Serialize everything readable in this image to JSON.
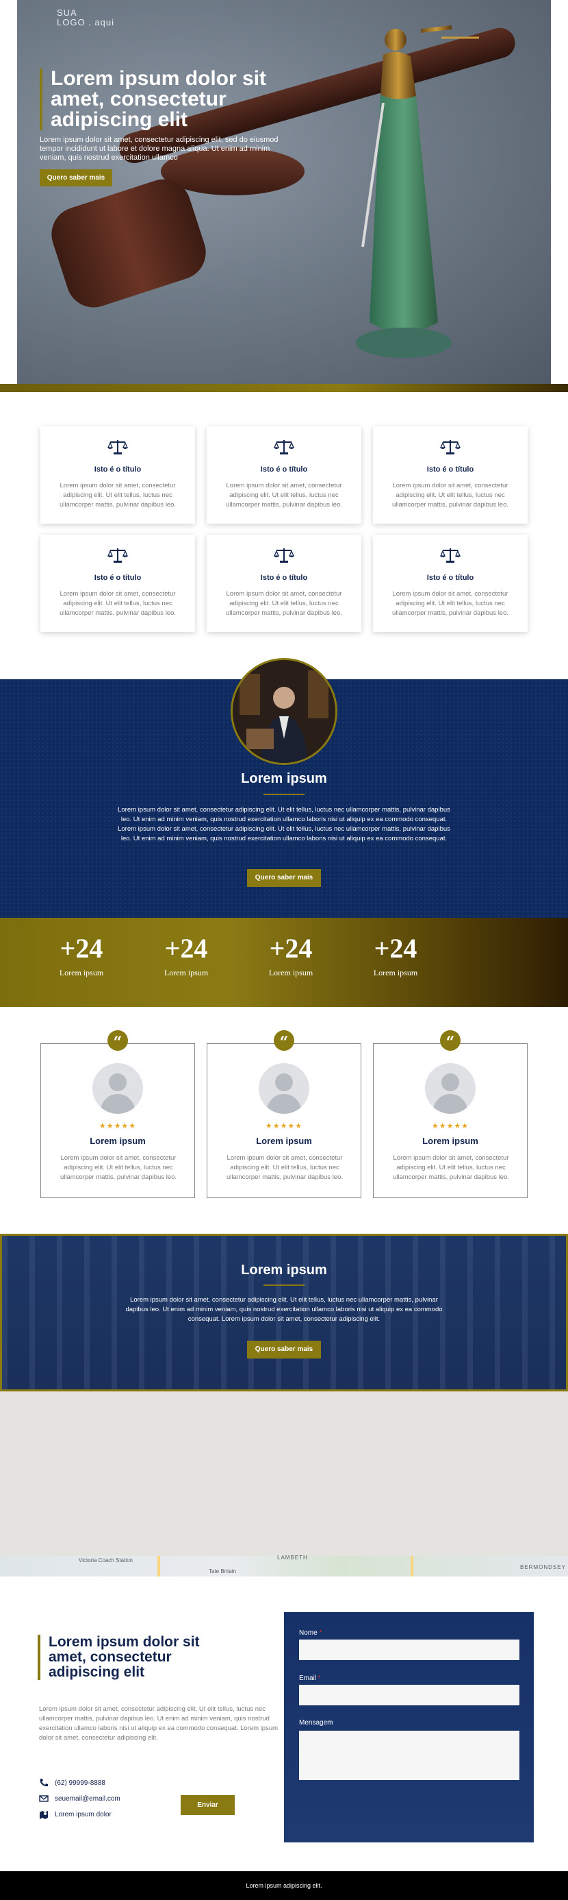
{
  "colors": {
    "navy": "#0f2a5e",
    "gold": "#8a7a12",
    "title_navy": "#14264f",
    "star": "#e8a41d"
  },
  "hero": {
    "logo_line1": "SUA",
    "logo_line2": "LOGO . aqui",
    "title": "Lorem ipsum dolor sit amet, consectetur adipiscing elit",
    "text": "Lorem ipsum dolor sit amet, consectetur adipiscing elit, sed do eiusmod tempor incididunt ut labore et dolore magna aliqua. Ut enim ad minim veniam, quis nostrud exercitation ullamco",
    "button": "Quero saber mais"
  },
  "services": {
    "icon": "scale-icon",
    "items": [
      {
        "title": "Isto é o título",
        "text": "Lorem ipsum dolor sit amet, consectetur adipiscing elit. Ut elit tellus, luctus nec ullamcorper mattis, pulvinar dapibus leo."
      },
      {
        "title": "Isto é o título",
        "text": "Lorem ipsum dolor sit amet, consectetur adipiscing elit. Ut elit tellus, luctus nec ullamcorper mattis, pulvinar dapibus leo."
      },
      {
        "title": "Isto é o título",
        "text": "Lorem ipsum dolor sit amet, consectetur adipiscing elit. Ut elit tellus, luctus nec ullamcorper mattis, pulvinar dapibus leo."
      },
      {
        "title": "Isto é o título",
        "text": "Lorem ipsum dolor sit amet, consectetur adipiscing elit. Ut elit tellus, luctus nec ullamcorper mattis, pulvinar dapibus leo."
      },
      {
        "title": "Isto é o título",
        "text": "Lorem ipsum dolor sit amet, consectetur adipiscing elit. Ut elit tellus, luctus nec ullamcorper mattis, pulvinar dapibus leo."
      },
      {
        "title": "Isto é o título",
        "text": "Lorem ipsum dolor sit amet, consectetur adipiscing elit. Ut elit tellus, luctus nec ullamcorper mattis, pulvinar dapibus leo."
      }
    ]
  },
  "about": {
    "title": "Lorem ipsum",
    "text": "Lorem ipsum dolor sit amet, consectetur adipiscing elit. Ut elit tellus, luctus nec ullamcorper mattis, pulvinar dapibus leo. Ut enim ad minim veniam, quis nostrud exercitation ullamco laboris nisi ut aliquip ex ea commodo consequat. Lorem ipsum dolor sit amet, consectetur adipiscing elit. Ut elit tellus, luctus nec ullamcorper mattis, pulvinar dapibus leo. Ut enim ad minim veniam, quis nostrud exercitation ullamco laboris nisi ut aliquip ex ea commodo consequat.",
    "button": "Quero saber mais"
  },
  "counters": [
    {
      "value": "+24",
      "label": "Lorem ipsum"
    },
    {
      "value": "+24",
      "label": "Lorem ipsum"
    },
    {
      "value": "+24",
      "label": "Lorem ipsum"
    },
    {
      "value": "+24",
      "label": "Lorem ipsum"
    }
  ],
  "testimonials": {
    "quote_glyph": "“",
    "stars": "★★★★★",
    "rating": 5,
    "items": [
      {
        "name": "Lorem ipsum",
        "text": "Lorem ipsum dolor sit amet, consectetur adipiscing elit. Ut elit tellus, luctus nec ullamcorper mattis, pulvinar dapibus leo."
      },
      {
        "name": "Lorem ipsum",
        "text": "Lorem ipsum dolor sit amet, consectetur adipiscing elit. Ut elit tellus, luctus nec ullamcorper mattis, pulvinar dapibus leo."
      },
      {
        "name": "Lorem ipsum",
        "text": "Lorem ipsum dolor sit amet, consectetur adipiscing elit. Ut elit tellus, luctus nec ullamcorper mattis, pulvinar dapibus leo."
      }
    ]
  },
  "cta": {
    "title": "Lorem ipsum",
    "text": "Lorem ipsum dolor sit amet, consectetur adipiscing elit. Ut elit tellus, luctus nec ullamcorper mattis, pulvinar dapibus leo. Ut enim ad minim veniam, quis nostrud exercitation ullamco laboris nisi ut aliquip ex ea commodo consequat. Lorem ipsum dolor sit amet, consectetur adipiscing elit.",
    "button": "Quero saber mais"
  },
  "map": {
    "labels": [
      "Victoria Coach Station",
      "LAMBETH",
      "Tate Britain",
      "BERMONDSEY"
    ]
  },
  "contact": {
    "title": "Lorem ipsum dolor sit amet, consectetur adipiscing elit",
    "text": "Lorem ipsum dolor sit amet, consectetur adipiscing elit. Ut elit tellus, luctus nec ullamcorper mattis, pulvinar dapibus leo. Ut enim ad minim veniam, quis nostrud exercitation ullamco laboris nisi ut aliquip ex ea commodo consequat. Lorem ipsum dolor sit amet, consectetur adipiscing elit.",
    "phone": "(62) 99999-8888",
    "email": "seuemail@email.com",
    "address": "Lorem ipsum dolor"
  },
  "form": {
    "name_label": "Nome",
    "email_label": "Email",
    "message_label": "Mensagem",
    "required_mark": "*",
    "submit": "Enviar"
  },
  "footer": {
    "text": "Lorem ipsum adipiscing elit."
  }
}
